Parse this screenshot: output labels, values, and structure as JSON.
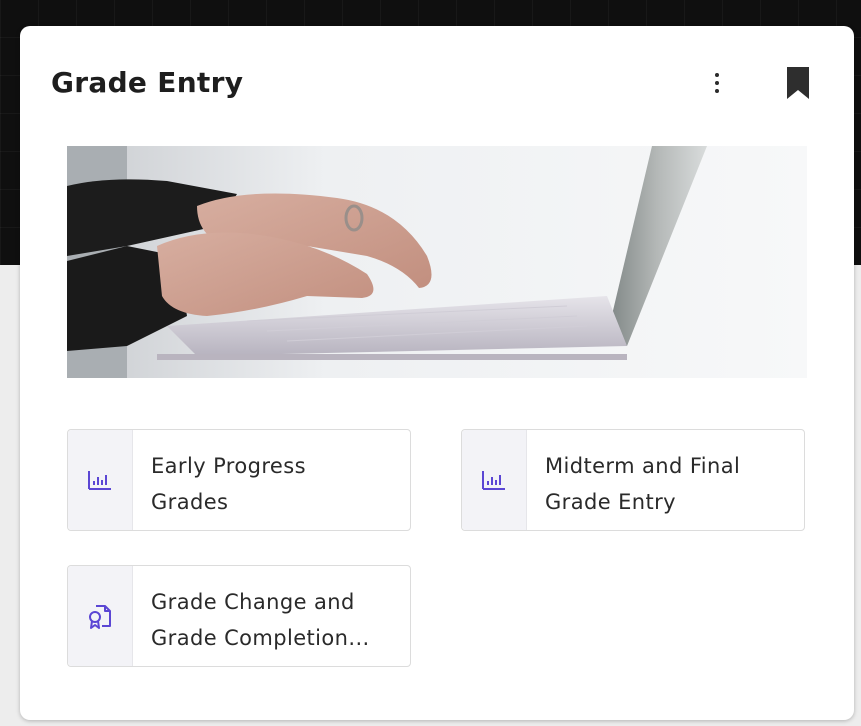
{
  "card": {
    "title": "Grade Entry"
  },
  "colors": {
    "icon_accent": "#5b46d4",
    "title_text": "#1e1e1e",
    "tile_icon_bg": "#f3f3f7"
  },
  "icons": {
    "more": "more-vertical-icon",
    "bookmark": "bookmark-icon",
    "tile1": "bar-chart-icon",
    "tile2": "bar-chart-icon",
    "tile3": "document-certificate-icon"
  },
  "hero_image": {
    "subject": "hands typing on laptop keyboard"
  },
  "tiles": [
    {
      "label": "Early Progress\nGrades"
    },
    {
      "label": "Midterm and Final\nGrade Entry"
    },
    {
      "label": "Grade Change and\nGrade Completion..."
    }
  ]
}
